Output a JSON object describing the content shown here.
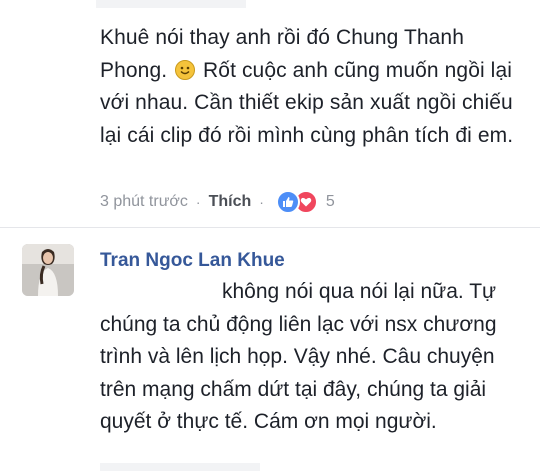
{
  "comment1": {
    "text_part1": "Khuê nói thay anh rồi đó Chung Thanh Phong. ",
    "emoji": "smile-emoji-icon",
    "text_part2": " Rốt cuộc anh cũng muốn ngồi lại với nhau. Cần thiết ekip sản xuất ngồi chiếu lại cái clip đó rồi mình cùng phân tích đi em.",
    "time": "3 phút trước",
    "like_label": "Thích",
    "reaction_count": "5"
  },
  "comment2": {
    "author": "Tran Ngoc Lan Khue",
    "text": "không nói qua nói lại nữa. Tự chúng ta chủ động liên lạc với nsx chương trình và lên lịch họp. Vậy nhé. Câu chuyện trên mạng chấm dứt tại đây, chúng ta giải quyết ở thực tế. Cám ơn mọi người."
  },
  "colors": {
    "author_link": "#365899",
    "meta_gray": "#90949c",
    "like_blue": "#4d8ef7",
    "love_red": "#f0465d"
  },
  "icons": [
    "smile-emoji-icon",
    "like-reaction-icon",
    "love-reaction-icon"
  ]
}
